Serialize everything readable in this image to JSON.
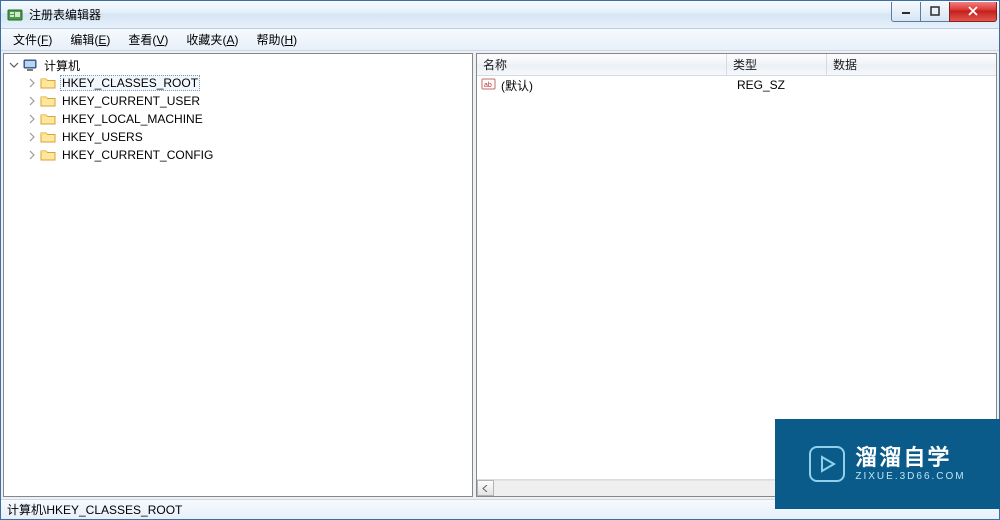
{
  "window": {
    "title": "注册表编辑器"
  },
  "menu": {
    "file": "文件",
    "file_accel": "F",
    "edit": "编辑",
    "edit_accel": "E",
    "view": "查看",
    "view_accel": "V",
    "fav": "收藏夹",
    "fav_accel": "A",
    "help": "帮助",
    "help_accel": "H"
  },
  "tree": {
    "root": "计算机",
    "nodes": [
      "HKEY_CLASSES_ROOT",
      "HKEY_CURRENT_USER",
      "HKEY_LOCAL_MACHINE",
      "HKEY_USERS",
      "HKEY_CURRENT_CONFIG"
    ],
    "selected_index": 0
  },
  "list": {
    "columns": {
      "name": "名称",
      "type": "类型",
      "data": "数据"
    },
    "rows": [
      {
        "name": "(默认)",
        "type": "REG_SZ",
        "data": ""
      }
    ]
  },
  "status": "计算机\\HKEY_CLASSES_ROOT",
  "watermark": {
    "title": "溜溜自学",
    "sub": "ZIXUE.3D66.COM"
  }
}
